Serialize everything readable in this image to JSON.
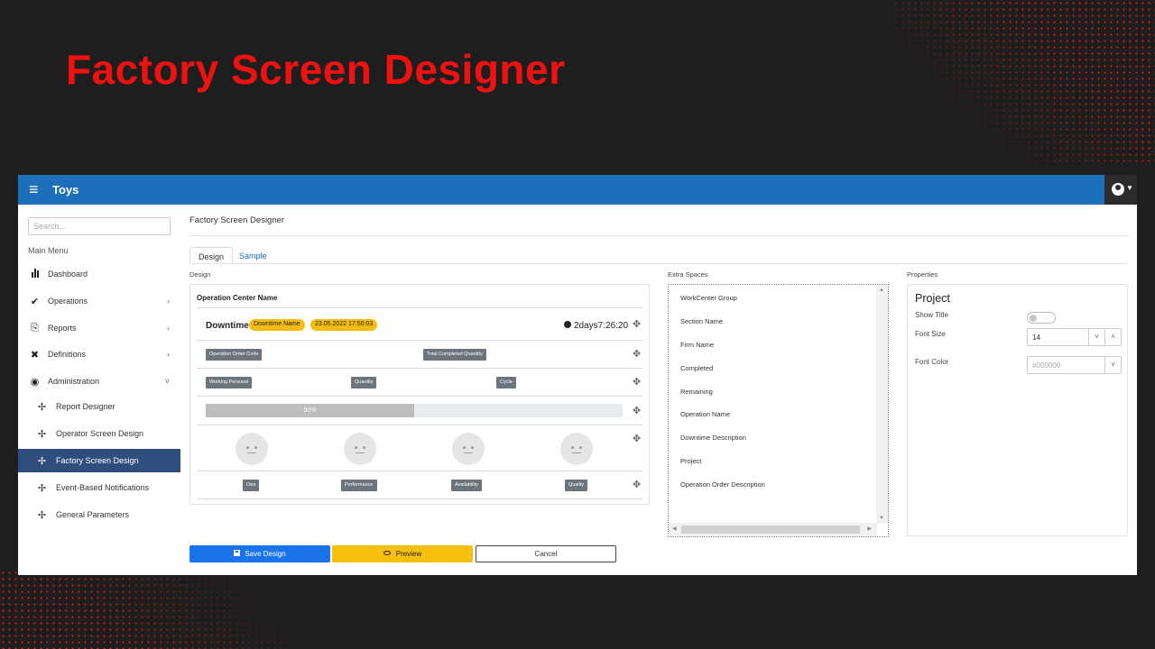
{
  "slide": {
    "title": "Factory Screen Designer"
  },
  "colors": {
    "accent_red": "#ee1111",
    "topbar_blue": "#1c6fb8",
    "active_nav": "#2f4e7e",
    "save_blue": "#1a73e8",
    "preview_yellow": "#f7bf10",
    "badge_gray": "#6c757d"
  },
  "topbar": {
    "app_name": "Toys",
    "menu_icon": "hamburger-icon",
    "user_icon": "user-circle-icon"
  },
  "sidebar": {
    "search_placeholder": "Search...",
    "main_menu_label": "Main Menu",
    "items": [
      {
        "label": "Dashboard",
        "icon": "bar-chart-icon"
      },
      {
        "label": "Operations",
        "icon": "satellite-dish-icon"
      },
      {
        "label": "Reports",
        "icon": "printer-icon"
      },
      {
        "label": "Definitions",
        "icon": "tools-icon"
      },
      {
        "label": "Administration",
        "icon": "user-shield-icon"
      },
      {
        "label": "Report Designer",
        "icon": "arrows-move-icon"
      },
      {
        "label": "Operator Screen Design",
        "icon": "arrows-move-icon"
      },
      {
        "label": "Factory Screen Design",
        "icon": "arrows-move-icon",
        "active": true
      },
      {
        "label": "Event-Based Notifications",
        "icon": "arrows-move-icon"
      },
      {
        "label": "General Parameters",
        "icon": "arrows-move-icon"
      }
    ]
  },
  "main": {
    "page_title": "Factory Screen Designer",
    "tabs": [
      {
        "label": "Design",
        "active": true
      },
      {
        "label": "Sample"
      }
    ],
    "design_label": "Design",
    "extra_label": "Extra Spaces",
    "props_label": "Properties"
  },
  "design": {
    "operation_center": "Operation Center Name",
    "downtime_title": "Downtime",
    "downtime_name_badge": "Downtime Name",
    "downtime_date_badge": "23.05.2022 17:50:03",
    "timer": "2days7:26:20",
    "row2": {
      "left": "Operation Order Code",
      "right": "Total Completed Quantity"
    },
    "row3": {
      "a": "Working Personel",
      "b": "Quantity",
      "c": "Cycle"
    },
    "progress": {
      "value": 0.5,
      "label": "50%"
    },
    "metrics": [
      "Oee",
      "Performance",
      "Availability",
      "Quality"
    ]
  },
  "extra_spaces": {
    "items": [
      "WorkCenter Group",
      "Section Name",
      "Firm Name",
      "Completed",
      "Remaining",
      "Operation Name",
      "Downtime Description",
      "Project",
      "Operation Order Description"
    ]
  },
  "properties": {
    "title": "Project",
    "show_title_label": "Show Title",
    "show_title_value": false,
    "font_size_label": "Font Size",
    "font_size_value": "14",
    "font_color_label": "Font Color",
    "font_color_placeholder": "#000000"
  },
  "actions": {
    "save": "Save Design",
    "preview": "Preview",
    "cancel": "Cancel"
  }
}
